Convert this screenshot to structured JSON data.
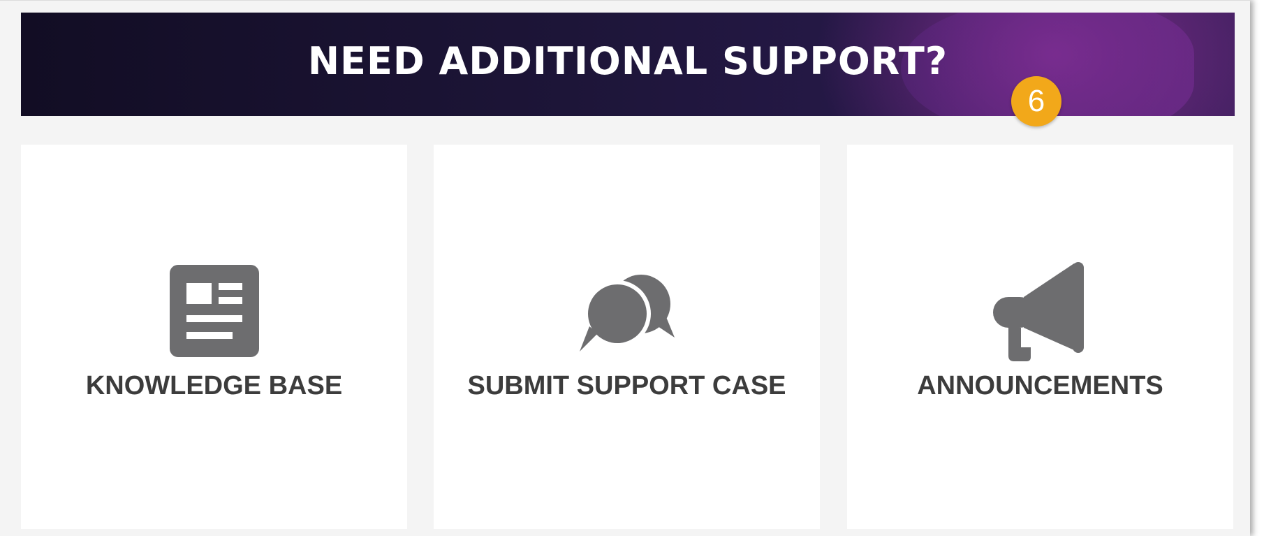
{
  "banner": {
    "title": "NEED ADDITIONAL SUPPORT?",
    "badge": "6"
  },
  "cards": [
    {
      "label": "KNOWLEDGE BASE",
      "icon": "document-icon"
    },
    {
      "label": "SUBMIT SUPPORT CASE",
      "icon": "chat-bubbles-icon"
    },
    {
      "label": "ANNOUNCEMENTS",
      "icon": "megaphone-icon"
    }
  ],
  "colors": {
    "banner_dark": "#120d24",
    "banner_purple": "#8c3096",
    "badge": "#f2a81a",
    "icon_gray": "#6d6d6f",
    "label_text": "#3c3c3c"
  }
}
